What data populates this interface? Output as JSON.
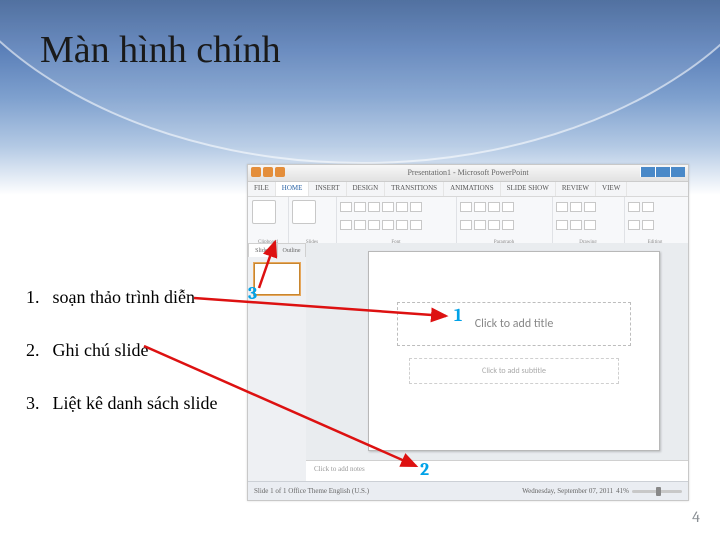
{
  "title": "Màn hình chính",
  "legend": [
    {
      "n": "1.",
      "t": "soạn thảo trình diễn"
    },
    {
      "n": "2.",
      "t": "Ghi chú slide"
    },
    {
      "n": "3.",
      "t": "Liệt kê danh sách slide"
    }
  ],
  "callouts": {
    "one": "1",
    "two": "2",
    "three": "3"
  },
  "page_number": "4",
  "pp": {
    "windowtitle": "Presentation1 - Microsoft PowerPoint",
    "tabs": [
      "FILE",
      "HOME",
      "INSERT",
      "DESIGN",
      "TRANSITIONS",
      "ANIMATIONS",
      "SLIDE SHOW",
      "REVIEW",
      "VIEW"
    ],
    "thumbtabs": [
      "Slides",
      "Outline"
    ],
    "ph_title": "Click to add title",
    "ph_sub": "Click to add subtitle",
    "notes": "Click to add notes",
    "status_left": "Slide 1 of 1   Office Theme   English (U.S.)",
    "status_right_date": "Wednesday, September 07, 2011",
    "zoom": "41%"
  }
}
